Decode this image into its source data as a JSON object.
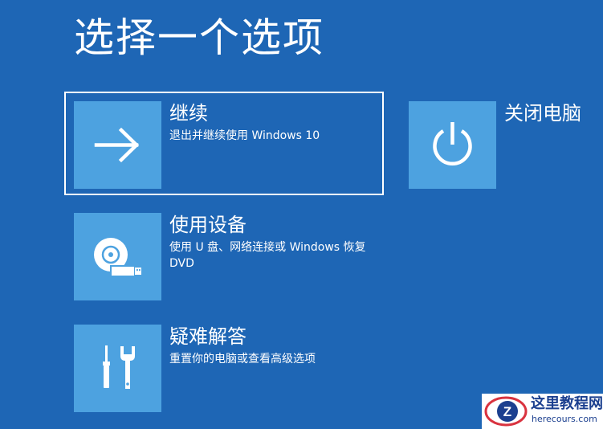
{
  "page": {
    "title": "选择一个选项"
  },
  "options": {
    "continue": {
      "label": "继续",
      "description": "退出并继续使用 Windows 10",
      "icon": "arrow-right-icon"
    },
    "use_device": {
      "label": "使用设备",
      "description": "使用 U 盘、网络连接或 Windows 恢复 DVD",
      "icon": "disc-usb-icon"
    },
    "troubleshoot": {
      "label": "疑难解答",
      "description": "重置你的电脑或查看高级选项",
      "icon": "screwdriver-wrench-icon"
    },
    "shutdown": {
      "label": "关闭电脑",
      "icon": "power-icon"
    }
  },
  "watermark": {
    "text_cn": "这里教程网",
    "text_en": "herecours.com",
    "logo_letter": "Z",
    "icon": "logo-icon"
  },
  "colors": {
    "background": "#1e66b5",
    "tile": "#4da2e0",
    "text": "#ffffff",
    "watermark_text": "#1b3f8f",
    "watermark_accent": "#d9333f"
  }
}
